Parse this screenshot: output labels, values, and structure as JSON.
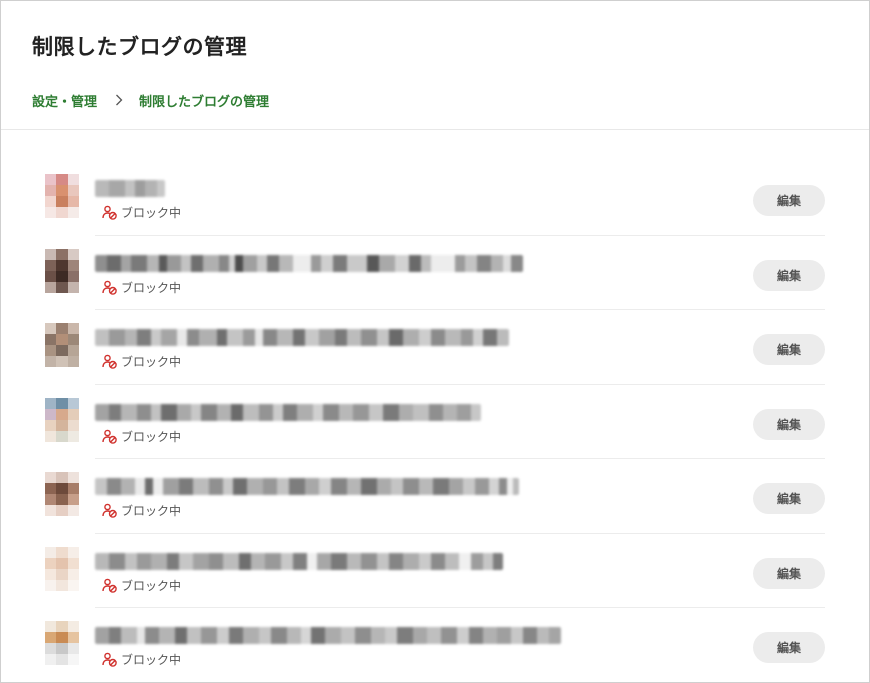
{
  "page": {
    "title": "制限したブログの管理"
  },
  "breadcrumb": {
    "parent": "設定・管理",
    "current": "制限したブログの管理"
  },
  "status_label": "ブロック中",
  "edit_label": "編集",
  "colors": {
    "accent_green": "#2e7d32",
    "block_icon_red": "#d0312d",
    "button_bg": "#ececec"
  },
  "blogs": [
    {
      "name": "",
      "status": "ブロック中",
      "action": "編集",
      "avatar": [
        "#eac3c9",
        "#d68a86",
        "#f0dedf",
        "#e3b3ae",
        "#d9916f",
        "#e9c7bd",
        "#f2d6cf",
        "#c9805f",
        "#e6b8a8",
        "#f6e8e5",
        "#f0d7d0",
        "#f5ebe8"
      ]
    },
    {
      "name": "",
      "status": "ブロック中",
      "action": "編集",
      "avatar": [
        "#c9b9b3",
        "#8c7166",
        "#d8cac4",
        "#7d6258",
        "#4f372f",
        "#9e857a",
        "#6b5047",
        "#3d2a24",
        "#8a7068",
        "#b8a59d",
        "#6e574f",
        "#c4b4ad"
      ]
    },
    {
      "name": "",
      "status": "ブロック中",
      "action": "編集",
      "avatar": [
        "#d7c8bd",
        "#9a8070",
        "#cab7aa",
        "#8a7466",
        "#b28f78",
        "#9c8878",
        "#a99382",
        "#7c6a5e",
        "#b6a596",
        "#c2b3a7",
        "#d0c2b6",
        "#bfb0a3"
      ]
    },
    {
      "name": "",
      "status": "ブロック中",
      "action": "編集",
      "avatar": [
        "#9fb4c6",
        "#6f8fa6",
        "#b8c8d6",
        "#cdb8c9",
        "#d7a98c",
        "#e4cdb9",
        "#e8d2c0",
        "#d4b49c",
        "#ecdccf",
        "#f0e6dc",
        "#d8d8cc",
        "#eeeae2"
      ]
    },
    {
      "name": "",
      "status": "ブロック中",
      "action": "編集",
      "avatar": [
        "#e9d9d2",
        "#d8c3b9",
        "#eee2dc",
        "#8c6452",
        "#6d4a3b",
        "#a77d68",
        "#b08774",
        "#8a6350",
        "#c79f8a",
        "#f1e3dc",
        "#e6cfc4",
        "#f3e9e4"
      ]
    },
    {
      "name": "",
      "status": "ブロック中",
      "action": "編集",
      "avatar": [
        "#f4ece6",
        "#efdcce",
        "#f6eee8",
        "#ecd2bf",
        "#e4c3ad",
        "#f1dfd1",
        "#f5e8de",
        "#ead5c6",
        "#f7eee7",
        "#f8f2ee",
        "#f2e6dd",
        "#faf5f1"
      ]
    },
    {
      "name": "",
      "status": "ブロック中",
      "action": "編集",
      "avatar": [
        "#f1e8dd",
        "#e8d4bd",
        "#f4ece3",
        "#d9a774",
        "#c98b54",
        "#e6c4a0",
        "#dcdcdc",
        "#c8c8c8",
        "#e8e8e8",
        "#f0f0f0",
        "#e4e4e4",
        "#f6f6f6"
      ]
    }
  ],
  "blur_bars": [
    [
      [
        "#b9b9b9",
        14
      ],
      [
        "#a7a7a7",
        16
      ],
      [
        "#c2c2c2",
        10
      ],
      [
        "#9d9d9d",
        10
      ],
      [
        "#b3b3b3",
        12
      ],
      [
        "#c8c8c8",
        8
      ]
    ],
    [
      [
        "#8f8f8f",
        12
      ],
      [
        "#6c6c6c",
        14
      ],
      [
        "#a4a4a4",
        10
      ],
      [
        "#7a7a7a",
        16
      ],
      [
        "#b6b6b6",
        12
      ],
      [
        "#5a5a5a",
        8
      ],
      [
        "#999",
        14
      ],
      [
        "#c3c3c3",
        10
      ],
      [
        "#6f6f6f",
        12
      ],
      [
        "#b0b0b0",
        16
      ],
      [
        "#888",
        10
      ],
      [
        "#d0d0d0",
        6
      ],
      [
        "#4d4d4d",
        8
      ],
      [
        "#a0a0a0",
        14
      ],
      [
        "#c8c8c8",
        10
      ],
      [
        "#777",
        12
      ],
      [
        "#b8b8b8",
        14
      ],
      [
        "#ededed",
        18
      ],
      [
        "#9a9a9a",
        10
      ],
      [
        "#cfcfcf",
        12
      ],
      [
        "#7b7b7b",
        14
      ],
      [
        "#c9c9c9",
        20
      ],
      [
        "#585858",
        12
      ],
      [
        "#a9a9a9",
        16
      ],
      [
        "#d2d2d2",
        14
      ],
      [
        "#6a6a6a",
        12
      ],
      [
        "#bcbcbc",
        10
      ],
      [
        "#ededed",
        24
      ],
      [
        "#9c9c9c",
        10
      ],
      [
        "#c4c4c4",
        12
      ],
      [
        "#848484",
        14
      ],
      [
        "#b3b3b3",
        12
      ],
      [
        "#dcdcdc",
        8
      ],
      [
        "#888",
        12
      ]
    ],
    [
      [
        "#c0c0c0",
        14
      ],
      [
        "#9a9a9a",
        16
      ],
      [
        "#b5b5b5",
        12
      ],
      [
        "#7e7e7e",
        14
      ],
      [
        "#c9c9c9",
        10
      ],
      [
        "#a5a5a5",
        16
      ],
      [
        "#e8e8e8",
        10
      ],
      [
        "#8c8c8c",
        12
      ],
      [
        "#b0b0b0",
        18
      ],
      [
        "#6f6f6f",
        10
      ],
      [
        "#c4c4c4",
        16
      ],
      [
        "#9b9b9b",
        12
      ],
      [
        "#e6e6e6",
        8
      ],
      [
        "#888",
        14
      ],
      [
        "#b7b7b7",
        16
      ],
      [
        "#737373",
        12
      ],
      [
        "#c8c8c8",
        14
      ],
      [
        "#a1a1a1",
        16
      ],
      [
        "#7a7a7a",
        12
      ],
      [
        "#bcbcbc",
        14
      ],
      [
        "#909090",
        16
      ],
      [
        "#c5c5c5",
        12
      ],
      [
        "#6a6a6a",
        14
      ],
      [
        "#aeaeae",
        16
      ],
      [
        "#cdcdcd",
        12
      ],
      [
        "#8b8b8b",
        14
      ],
      [
        "#b9b9b9",
        16
      ],
      [
        "#999",
        12
      ],
      [
        "#d0d0d0",
        10
      ],
      [
        "#777",
        14
      ],
      [
        "#bbbbbb",
        12
      ]
    ],
    [
      [
        "#a3a3a3",
        14
      ],
      [
        "#7d7d7d",
        12
      ],
      [
        "#b6b6b6",
        16
      ],
      [
        "#8e8e8e",
        14
      ],
      [
        "#c2c2c2",
        10
      ],
      [
        "#6e6e6e",
        16
      ],
      [
        "#a9a9a9",
        14
      ],
      [
        "#c8c8c8",
        10
      ],
      [
        "#858585",
        16
      ],
      [
        "#b2b2b2",
        14
      ],
      [
        "#6b6b6b",
        12
      ],
      [
        "#bdbdbd",
        16
      ],
      [
        "#949494",
        14
      ],
      [
        "#cbcbcb",
        10
      ],
      [
        "#7f7f7f",
        14
      ],
      [
        "#aeaeae",
        16
      ],
      [
        "#d0d0d0",
        10
      ],
      [
        "#8a8a8a",
        16
      ],
      [
        "#b8b8b8",
        14
      ],
      [
        "#979797",
        16
      ],
      [
        "#c6c6c6",
        14
      ],
      [
        "#7a7a7a",
        16
      ],
      [
        "#adadad",
        14
      ],
      [
        "#c0c0c0",
        16
      ],
      [
        "#8f8f8f",
        14
      ],
      [
        "#b4b4b4",
        14
      ],
      [
        "#9e9e9e",
        14
      ],
      [
        "#c7c7c7",
        10
      ]
    ],
    [
      [
        "#c5c5c5",
        12
      ],
      [
        "#8a8a8a",
        14
      ],
      [
        "#b2b2b2",
        14
      ],
      [
        "#e9e9e9",
        10
      ],
      [
        "#6d6d6d",
        8
      ],
      [
        "#ededed",
        10
      ],
      [
        "#a0a0a0",
        16
      ],
      [
        "#7b7b7b",
        14
      ],
      [
        "#bcbcbc",
        16
      ],
      [
        "#909090",
        14
      ],
      [
        "#c9c9c9",
        10
      ],
      [
        "#6f6f6f",
        14
      ],
      [
        "#b0b0b0",
        16
      ],
      [
        "#989898",
        14
      ],
      [
        "#c3c3c3",
        12
      ],
      [
        "#7d7d7d",
        16
      ],
      [
        "#a8a8a8",
        14
      ],
      [
        "#cfcfcf",
        12
      ],
      [
        "#858585",
        16
      ],
      [
        "#b6b6b6",
        14
      ],
      [
        "#717171",
        16
      ],
      [
        "#ababab",
        14
      ],
      [
        "#c4c4c4",
        12
      ],
      [
        "#8e8e8e",
        16
      ],
      [
        "#b9b9b9",
        14
      ],
      [
        "#7a7a7a",
        16
      ],
      [
        "#a4a4a4",
        14
      ],
      [
        "#c8c8c8",
        12
      ],
      [
        "#999",
        14
      ],
      [
        "#d4d4d4",
        10
      ],
      [
        "#8c8c8c",
        8
      ],
      [
        "#eeeeee",
        6
      ],
      [
        "#bbbbbb",
        6
      ]
    ],
    [
      [
        "#b8b8b8",
        14
      ],
      [
        "#8c8c8c",
        16
      ],
      [
        "#c2c2c2",
        12
      ],
      [
        "#9a9a9a",
        14
      ],
      [
        "#b0b0b0",
        16
      ],
      [
        "#7c7c7c",
        12
      ],
      [
        "#c6c6c6",
        14
      ],
      [
        "#a3a3a3",
        16
      ],
      [
        "#8f8f8f",
        14
      ],
      [
        "#bcbcbc",
        16
      ],
      [
        "#6f6f6f",
        12
      ],
      [
        "#b4b4b4",
        14
      ],
      [
        "#999",
        16
      ],
      [
        "#c8c8c8",
        12
      ],
      [
        "#808080",
        14
      ],
      [
        "#f0f0f0",
        10
      ],
      [
        "#a7a7a7",
        14
      ],
      [
        "#7a7a7a",
        16
      ],
      [
        "#b9b9b9",
        14
      ],
      [
        "#929292",
        16
      ],
      [
        "#c4c4c4",
        12
      ],
      [
        "#858585",
        14
      ],
      [
        "#adadad",
        16
      ],
      [
        "#cacaca",
        12
      ],
      [
        "#8b8b8b",
        14
      ],
      [
        "#bdbdbd",
        14
      ],
      [
        "#f0f0f0",
        12
      ],
      [
        "#9d9d9d",
        12
      ],
      [
        "#c6c6c6",
        10
      ],
      [
        "#7e7e7e",
        10
      ]
    ],
    [
      [
        "#a2a2a2",
        14
      ],
      [
        "#7f7f7f",
        12
      ],
      [
        "#bcbcbc",
        16
      ],
      [
        "#e6e6e6",
        8
      ],
      [
        "#8c8c8c",
        14
      ],
      [
        "#b4b4b4",
        16
      ],
      [
        "#6f6f6f",
        12
      ],
      [
        "#c1c1c1",
        14
      ],
      [
        "#979797",
        16
      ],
      [
        "#cccccc",
        12
      ],
      [
        "#7a7a7a",
        14
      ],
      [
        "#afafaf",
        16
      ],
      [
        "#c6c6c6",
        12
      ],
      [
        "#898989",
        16
      ],
      [
        "#b8b8b8",
        14
      ],
      [
        "#d6d6d6",
        10
      ],
      [
        "#737373",
        14
      ],
      [
        "#ababab",
        16
      ],
      [
        "#c3c3c3",
        14
      ],
      [
        "#8e8e8e",
        16
      ],
      [
        "#b6b6b6",
        14
      ],
      [
        "#c9c9c9",
        12
      ],
      [
        "#7d7d7d",
        16
      ],
      [
        "#a8a8a8",
        14
      ],
      [
        "#bfbfbf",
        14
      ],
      [
        "#929292",
        16
      ],
      [
        "#cdcdcd",
        12
      ],
      [
        "#848484",
        14
      ],
      [
        "#b1b1b1",
        14
      ],
      [
        "#9f9f9f",
        14
      ],
      [
        "#c7c7c7",
        12
      ],
      [
        "#878787",
        14
      ],
      [
        "#bababa",
        12
      ],
      [
        "#a5a5a5",
        12
      ]
    ]
  ]
}
